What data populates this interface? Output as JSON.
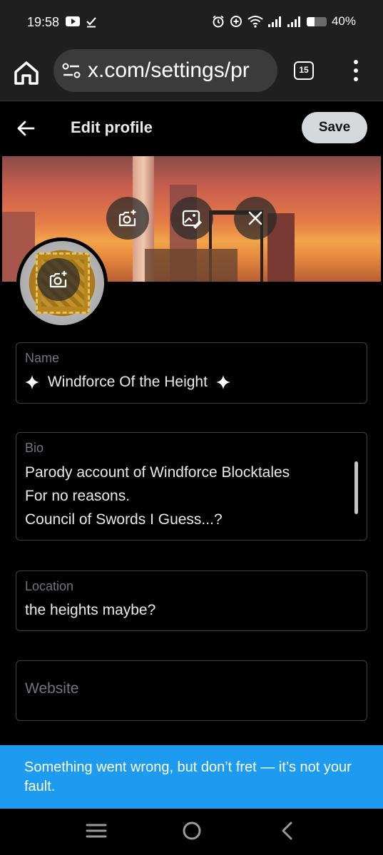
{
  "status_bar": {
    "time": "19:58",
    "battery_percent": "40%",
    "battery_level": 0.4
  },
  "browser": {
    "url": "x.com/settings/pr",
    "tab_count": "15"
  },
  "header": {
    "title": "Edit profile",
    "save_label": "Save"
  },
  "form": {
    "name": {
      "label": "Name",
      "value": "Windforce Of the Height"
    },
    "bio": {
      "label": "Bio",
      "lines": [
        "Parody account of Windforce Blocktales",
        "For no reasons.",
        "Council of Swords I Guess...?"
      ]
    },
    "location": {
      "label": "Location",
      "value": "the heights maybe?"
    },
    "website": {
      "label": "Website",
      "value": ""
    }
  },
  "toast": {
    "message": "Something went wrong, but don’t fret — it’s not your fault."
  },
  "colors": {
    "accent": "#1d9bf0",
    "background": "#000000",
    "border": "#3e4144",
    "label": "#71767b",
    "text": "#e7e9ea",
    "save_button": "#d6d9db"
  },
  "icons": {
    "home": "home-icon",
    "tune": "tune-icon",
    "kebab": "more-vert-icon",
    "back": "arrow-left-icon",
    "banner_camera": "add-photo-icon",
    "banner_edit": "edit-photo-icon",
    "banner_remove": "close-icon",
    "avatar_camera": "add-photo-icon",
    "nav_recents": "recents-icon",
    "nav_home": "nav-home-icon",
    "nav_back": "nav-back-icon"
  }
}
